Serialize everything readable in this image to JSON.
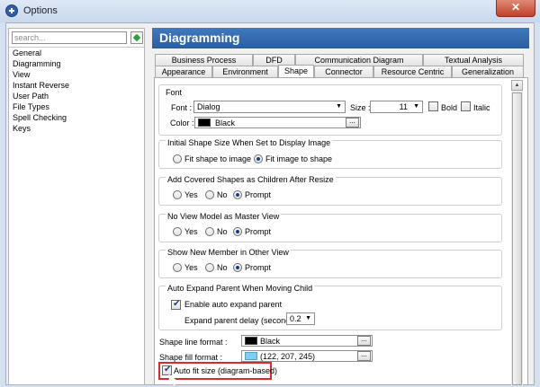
{
  "window": {
    "title": "Options",
    "close_glyph": "✕"
  },
  "search": {
    "placeholder": "search..."
  },
  "categories": [
    "General",
    "Diagramming",
    "View",
    "Instant Reverse",
    "User Path",
    "File Types",
    "Spell Checking",
    "Keys"
  ],
  "header": {
    "title": "Diagramming"
  },
  "tabs": {
    "row1": [
      "Business Process",
      "DFD",
      "Communication Diagram",
      "Textual Analysis"
    ],
    "row2": [
      "Appearance",
      "Environment",
      "Shape",
      "Connector",
      "Resource Centric",
      "Generalization"
    ],
    "active": "Shape"
  },
  "font_group": {
    "title": "Font",
    "font_label": "Font :",
    "font_value": "Dialog",
    "size_label": "Size :",
    "size_value": "11",
    "bold_label": "Bold",
    "italic_label": "Italic",
    "color_label": "Color :",
    "color_value": "Black",
    "color_hex": "#000000"
  },
  "initial_shape_group": {
    "title": "Initial Shape Size When Set to Display Image",
    "options": [
      "Fit shape to image",
      "Fit image to shape"
    ],
    "selected": "Fit image to shape"
  },
  "covered_group": {
    "title": "Add Covered Shapes as Children After Resize",
    "options": [
      "Yes",
      "No",
      "Prompt"
    ],
    "selected": "Prompt"
  },
  "no_view_group": {
    "title": "No View Model as Master View",
    "options": [
      "Yes",
      "No",
      "Prompt"
    ],
    "selected": "Prompt"
  },
  "new_member_group": {
    "title": "Show New Member in Other View",
    "options": [
      "Yes",
      "No",
      "Prompt"
    ],
    "selected": "Prompt"
  },
  "auto_expand_group": {
    "title": "Auto Expand Parent When Moving Child",
    "enable_label": "Enable auto expand parent",
    "enable_checked": true,
    "delay_label": "Expand parent delay (second):",
    "delay_value": "0.2"
  },
  "shape_line": {
    "label": "Shape line format :",
    "value": "Black",
    "color_hex": "#000000"
  },
  "shape_fill": {
    "label": "Shape fill format :",
    "value": "(122, 207, 245)",
    "color_hex": "#7acff5"
  },
  "auto_fit": {
    "label": "Auto fit size (diagram-based)",
    "checked": true
  },
  "ellipsis": "...",
  "dropdown_glyph": "▼",
  "colors": {
    "header": "#2f68ad",
    "highlight": "#d9292d"
  }
}
